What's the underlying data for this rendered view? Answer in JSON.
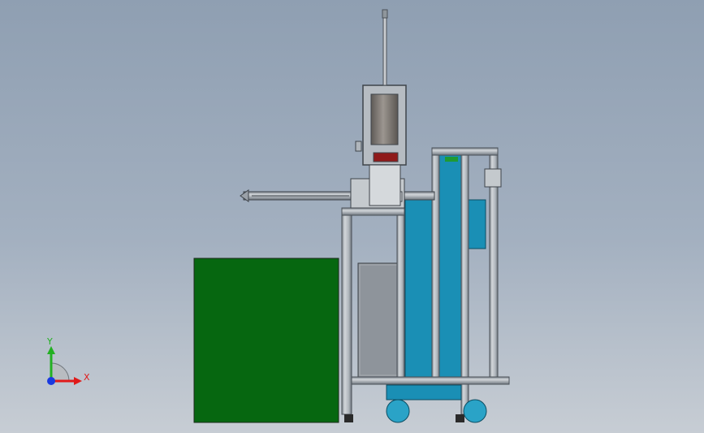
{
  "viewport": {
    "background_top": "#8f9fb2",
    "background_bottom": "#c7cdd4"
  },
  "model": {
    "green_panel_color": "#066710",
    "blue_tank_color": "#1a8fb5",
    "frame_color": "#b9bec4",
    "gray_cabinet_color": "#8e949b",
    "red_block_color": "#8f1a1a",
    "cylinder_color": "#7a7570",
    "wheel_color": "#2aa3c7"
  },
  "triad": {
    "x_label": "X",
    "y_label": "Y",
    "x_color": "#e01a1a",
    "y_color": "#22b022",
    "z_color": "#1a3ae0"
  }
}
